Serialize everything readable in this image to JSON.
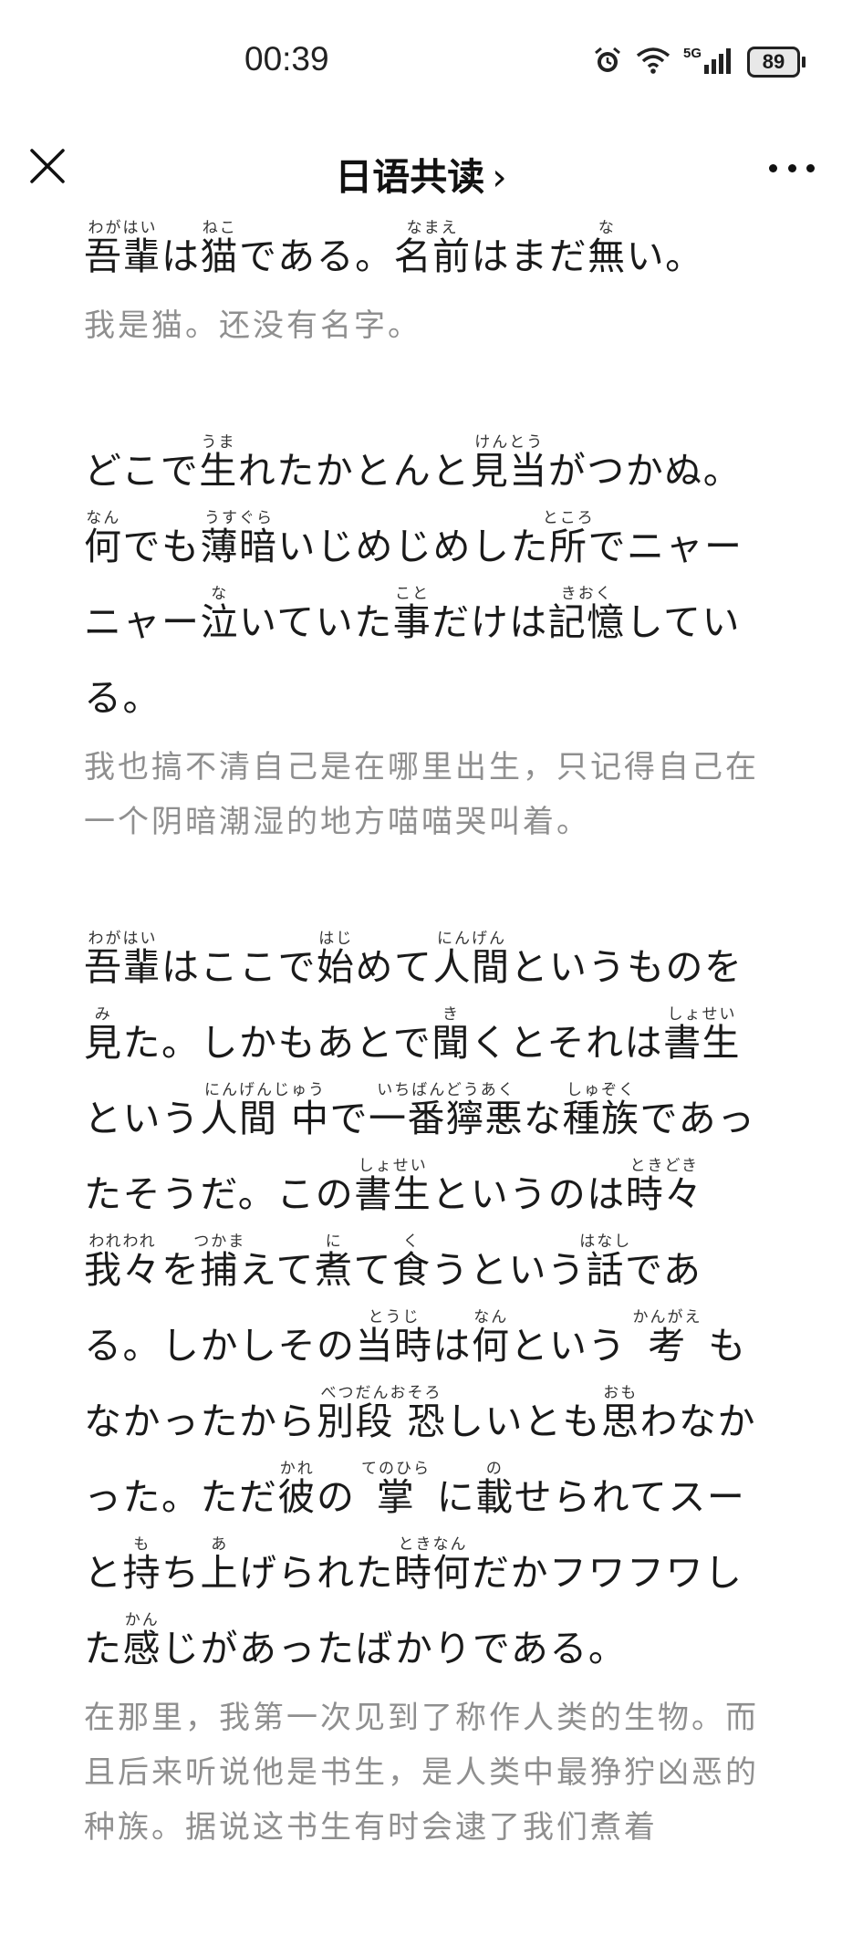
{
  "status": {
    "time": "00:39",
    "network": "5G",
    "battery": "89",
    "icons": [
      "alarm-icon",
      "wifi-icon",
      "signal-icon",
      "battery-icon"
    ]
  },
  "nav": {
    "title": "日语共读",
    "chevron": "›",
    "icons": [
      "close-icon",
      "more-icon"
    ]
  },
  "paragraphs": [
    {
      "jp_runs": [
        {
          "t": "吾輩",
          "r": "わがはい"
        },
        {
          "t": "は"
        },
        {
          "t": "猫",
          "r": "ねこ"
        },
        {
          "t": "である。"
        },
        {
          "t": "名前",
          "r": "なまえ"
        },
        {
          "t": "はまだ"
        },
        {
          "t": "無",
          "r": "な"
        },
        {
          "t": "い。"
        }
      ],
      "zh": "我是猫。还没有名字。"
    },
    {
      "jp_runs": [
        {
          "t": "どこで"
        },
        {
          "t": "生",
          "r": "うま"
        },
        {
          "t": "れたかとんと"
        },
        {
          "t": "見当",
          "r": "けんとう"
        },
        {
          "t": "がつかぬ。"
        },
        {
          "t": "何",
          "r": "なん"
        },
        {
          "t": "でも"
        },
        {
          "t": "薄暗",
          "r": "うすぐら"
        },
        {
          "t": "いじめじめした"
        },
        {
          "t": "所",
          "r": "ところ"
        },
        {
          "t": "でニャーニャー"
        },
        {
          "t": "泣",
          "r": "な"
        },
        {
          "t": "いていた"
        },
        {
          "t": "事",
          "r": "こと"
        },
        {
          "t": "だけは"
        },
        {
          "t": "記憶",
          "r": "きおく"
        },
        {
          "t": "している。"
        }
      ],
      "zh": "我也搞不清自己是在哪里出生，只记得自己在一个阴暗潮湿的地方喵喵哭叫着。"
    },
    {
      "jp_runs": [
        {
          "t": "吾輩",
          "r": "わがはい"
        },
        {
          "t": "はここで"
        },
        {
          "t": "始",
          "r": "はじ"
        },
        {
          "t": "めて"
        },
        {
          "t": "人間",
          "r": "にんげん"
        },
        {
          "t": "というものを"
        },
        {
          "t": "見",
          "r": "み"
        },
        {
          "t": "た。しかもあとで"
        },
        {
          "t": "聞",
          "r": "き"
        },
        {
          "t": "くとそれは"
        },
        {
          "t": "書生",
          "r": "しょせい"
        },
        {
          "t": "という"
        },
        {
          "t": "人間 中",
          "r": "にんげんじゅう"
        },
        {
          "t": "で"
        },
        {
          "t": "一番獰悪",
          "r": "いちばんどうあく"
        },
        {
          "t": "な"
        },
        {
          "t": "種族",
          "r": "しゅぞく"
        },
        {
          "t": "であったそうだ。この"
        },
        {
          "t": "書生",
          "r": "しょせい"
        },
        {
          "t": "というのは"
        },
        {
          "t": "時々",
          "r": "ときどき"
        },
        {
          "t": "我々",
          "r": "われわれ"
        },
        {
          "t": "を"
        },
        {
          "t": "捕",
          "r": "つかま"
        },
        {
          "t": "えて"
        },
        {
          "t": "煮",
          "r": "に"
        },
        {
          "t": "て"
        },
        {
          "t": "食",
          "r": "く"
        },
        {
          "t": "うという"
        },
        {
          "t": "話",
          "r": "はなし"
        },
        {
          "t": "である。しかしその"
        },
        {
          "t": "当時",
          "r": "とうじ"
        },
        {
          "t": "は"
        },
        {
          "t": "何",
          "r": "なん"
        },
        {
          "t": "という "
        },
        {
          "t": "考",
          "r": "かんがえ"
        },
        {
          "t": " もなかったから"
        },
        {
          "t": "別段 恐",
          "r": "べつだんおそろ"
        },
        {
          "t": "しいとも"
        },
        {
          "t": "思",
          "r": "おも"
        },
        {
          "t": "わなかった。ただ"
        },
        {
          "t": "彼",
          "r": "かれ"
        },
        {
          "t": "の "
        },
        {
          "t": "掌",
          "r": "てのひら"
        },
        {
          "t": " に"
        },
        {
          "t": "載",
          "r": "の"
        },
        {
          "t": "せられてスーと"
        },
        {
          "t": "持",
          "r": "も"
        },
        {
          "t": "ち"
        },
        {
          "t": "上",
          "r": "あ"
        },
        {
          "t": "げられた"
        },
        {
          "t": "時何",
          "r": "ときなん"
        },
        {
          "t": "だかフワフワした"
        },
        {
          "t": "感",
          "r": "かん"
        },
        {
          "t": "じがあったばかりである。"
        }
      ],
      "zh": "在那里，我第一次见到了称作人类的生物。而且后来听说他是书生，是人类中最狰狞凶恶的种族。据说这书生有时会逮了我们煮着"
    }
  ]
}
